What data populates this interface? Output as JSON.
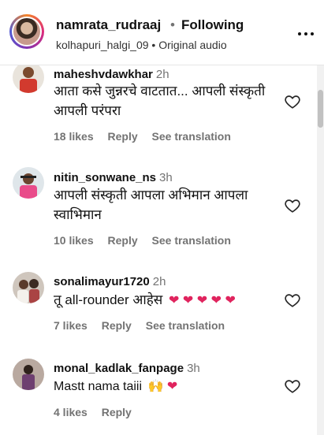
{
  "header": {
    "username": "namrata_rudraaj",
    "separator": "•",
    "follow_status": "Following",
    "subtitle": "kolhapuri_halgi_09 • Original audio"
  },
  "comments": [
    {
      "username": "maheshvdawkhar",
      "time": "2h",
      "text": "आता कसे जुन्नरचे वाटतात... आपली संस्कृती आपली परंपरा",
      "likes": "18 likes",
      "reply": "Reply",
      "translate": "See translation"
    },
    {
      "username": "nitin_sonwane_ns",
      "time": "3h",
      "text": "आपली संस्कृती आपला अभिमान आपला स्वाभिमान",
      "likes": "10 likes",
      "reply": "Reply",
      "translate": "See translation"
    },
    {
      "username": "sonalimayur1720",
      "time": "2h",
      "text": "तू all-rounder आहेस",
      "emoji": "❤ ❤ ❤ ❤ ❤",
      "likes": "7 likes",
      "reply": "Reply",
      "translate": "See translation"
    },
    {
      "username": "monal_kadlak_fanpage",
      "time": "3h",
      "text": "Mastt nama taiii",
      "emoji": "🙌 ❤",
      "likes": "4 likes",
      "reply": "Reply"
    }
  ],
  "icons": {
    "header_more": "more-options-icon",
    "like": "heart-outline-icon"
  },
  "colors": {
    "text": "#111111",
    "muted": "#737373",
    "heart_emoji": "#e0245e"
  }
}
